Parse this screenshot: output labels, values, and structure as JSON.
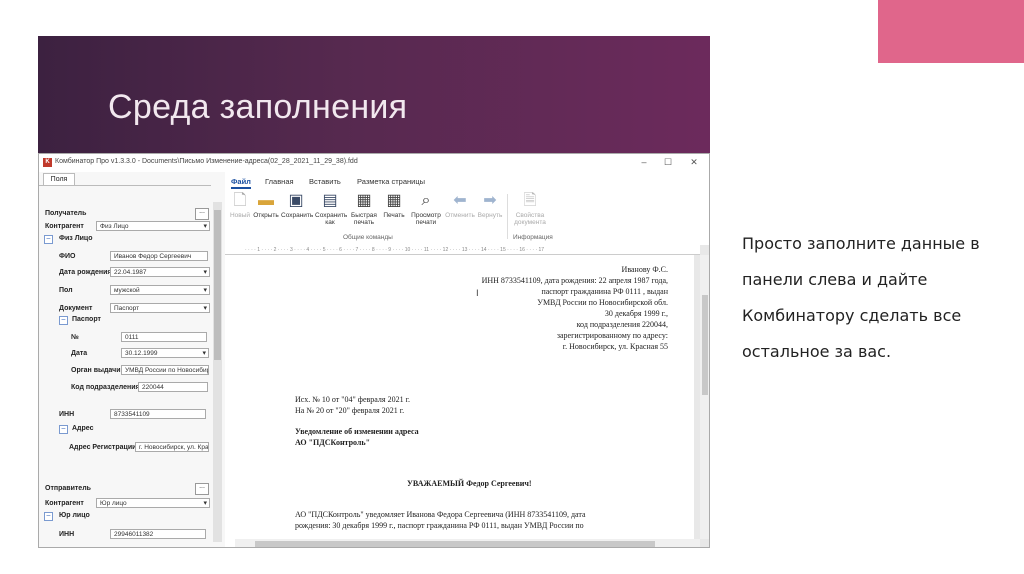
{
  "slide": {
    "title": "Среда заполнения",
    "description": "Просто заполните данные в панели слева и дайте Комбинатору сделать все остальное за вас."
  },
  "app": {
    "window_title": "Комбинатор Про v1.3.3.0 - Documents\\Письмо Изменение-адреса(02_28_2021_11_29_38).fdd",
    "left_tab": "Поля",
    "fields": {
      "sender_section": "Получатель",
      "counterparty_label": "Контрагент",
      "counterparty_value": "Физ Лицо",
      "individual_group": "Физ Лицо",
      "fio_label": "ФИО",
      "fio_value": "Иванов Федор Сергеевич",
      "birth_label": "Дата рождения",
      "birth_value": "22.04.1987",
      "gender_label": "Пол",
      "gender_value": "мужской",
      "doc_label": "Документ",
      "doc_value": "Паспорт",
      "passport_group": "Паспорт",
      "num_label": "№",
      "num_value": "0111",
      "date_label": "Дата",
      "date_value": "30.12.1999",
      "issuer_label": "Орган выдачи",
      "issuer_value": "УМВД России по Новосибирской обл.",
      "dept_label": "Код подразделения",
      "dept_value": "220044",
      "inn_label": "ИНН",
      "inn_value": "8733541109",
      "address_group": "Адрес",
      "reg_label": "Адрес Регистрации",
      "reg_value": "г. Новосибирск, ул. Красная 55",
      "sender2_section": "Отправитель",
      "counterparty2_label": "Контрагент",
      "counterparty2_value": "Юр лицо",
      "legal_group": "Юр лицо",
      "inn2_label": "ИНН",
      "inn2_value": "29946011382"
    },
    "ribbon": {
      "tabs": [
        "Файл",
        "Главная",
        "Вставить",
        "Разметка страницы"
      ],
      "buttons": [
        "Новый",
        "Открыть",
        "Сохранить",
        "Сохранить как",
        "Быстрая печать",
        "Печать",
        "Просмотр печати",
        "Отменить",
        "Вернуть",
        "Свойства документа"
      ],
      "groups": [
        "Общие команды",
        "Информация"
      ]
    },
    "document": {
      "addressee": [
        "Иванову Ф.С.",
        "ИНН 8733541109, дата рождения: 22 апреля 1987 года,",
        "паспорт гражданина РФ 0111 , выдан",
        "УМВД России по Новосибирской обл.",
        "30 декабря 1999 г.,",
        "код подразделения 220044,",
        "зарегистрированному по адресу:",
        "г. Новосибирск, ул. Красная 55"
      ],
      "ref1": "Исх. №  10  от \"04\" февраля 2021 г.",
      "ref2": "На №    20 от \"20\" февраля 2021 г.",
      "subject1": "Уведомление об изменении адреса",
      "subject2": "АО \"ПДСКонтроль\"",
      "greeting": "УВАЖАЕМЫЙ Федор Сергеевич!",
      "body1": "АО \"ПДСКонтроль\" уведомляет  Иванова Федора Сергеевича (ИНН 8733541109, дата",
      "body2": "рождения: 30 декабря 1999 г., паспорт гражданина РФ 0111, выдан  УМВД России по"
    }
  }
}
